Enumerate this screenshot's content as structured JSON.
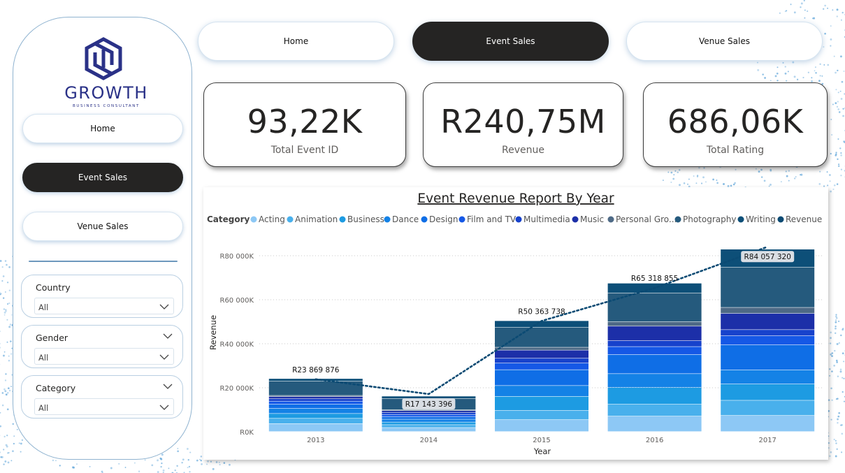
{
  "brand": {
    "name": "GROWTH",
    "tagline": "BUSINESS CONSULTANT",
    "color": "#2a3187"
  },
  "nav": {
    "sidebar": [
      {
        "label": "Home",
        "active": false
      },
      {
        "label": "Event Sales",
        "active": true
      },
      {
        "label": "Venue Sales",
        "active": false
      }
    ],
    "top": [
      {
        "label": "Home",
        "active": false
      },
      {
        "label": "Event Sales",
        "active": true
      },
      {
        "label": "Venue Sales",
        "active": false
      }
    ]
  },
  "filters": [
    {
      "title": "Country",
      "value": "All"
    },
    {
      "title": "Gender",
      "value": "All"
    },
    {
      "title": "Category",
      "value": "All"
    }
  ],
  "kpis": [
    {
      "value": "93,22K",
      "label": "Total Event ID"
    },
    {
      "value": "R240,75M",
      "label": "Revenue"
    },
    {
      "value": "686,06K",
      "label": "Total Rating"
    }
  ],
  "chart_data": {
    "type": "bar",
    "stacked": true,
    "title": "Event Revenue Report By Year",
    "xlabel": "Year",
    "ylabel": "Revenue",
    "legend_title": "Category",
    "legend_position": "top-left",
    "categories": [
      "2013",
      "2014",
      "2015",
      "2016",
      "2017"
    ],
    "ylim": [
      0,
      80000
    ],
    "yticks": [
      0,
      20000,
      40000,
      60000,
      80000
    ],
    "ytick_labels": [
      "R0K",
      "R20 000K",
      "R40 000K",
      "R60 000K",
      "R80 000K"
    ],
    "series": [
      {
        "name": "Acting",
        "color": "#8dc8f5",
        "values": [
          3600,
          1800,
          5400,
          7000,
          7300
        ]
      },
      {
        "name": "Animation",
        "color": "#49b0ec",
        "values": [
          2400,
          1300,
          4200,
          5400,
          6900
        ]
      },
      {
        "name": "Business",
        "color": "#1d9be2",
        "values": [
          2200,
          1200,
          6400,
          7600,
          7400
        ]
      },
      {
        "name": "Dance",
        "color": "#1482e6",
        "values": [
          2300,
          1300,
          4900,
          6300,
          6400
        ]
      },
      {
        "name": "Design",
        "color": "#0f6ee6",
        "values": [
          1900,
          1100,
          7200,
          8700,
          11400
        ]
      },
      {
        "name": "Film and TV",
        "color": "#1558e6",
        "values": [
          1400,
          1000,
          3000,
          3600,
          4100
        ]
      },
      {
        "name": "Multimedia",
        "color": "#1742cc",
        "values": [
          1100,
          900,
          2200,
          2700,
          2800
        ]
      },
      {
        "name": "Music",
        "color": "#1c2fa8",
        "values": [
          1000,
          900,
          3700,
          6600,
          7400
        ]
      },
      {
        "name": "Personal Gro...",
        "color": "#4e6a86",
        "values": [
          500,
          400,
          1300,
          2000,
          2700
        ]
      },
      {
        "name": "Photography",
        "color": "#255a7d",
        "values": [
          6500,
          5100,
          9000,
          13100,
          18200
        ]
      },
      {
        "name": "Writing",
        "color": "#0d4f78",
        "values": [
          1170,
          1100,
          3060,
          4420,
          8260
        ]
      }
    ],
    "line": {
      "name": "Revenue",
      "color": "#0b4a73",
      "values": [
        23869876,
        17143396,
        50363738,
        65318855,
        84057320
      ]
    },
    "data_labels": [
      "R23 869 876",
      "R17 143 396",
      "R50 363 738",
      "R65 318 855",
      "R84 057 320"
    ],
    "gridlines": true
  }
}
